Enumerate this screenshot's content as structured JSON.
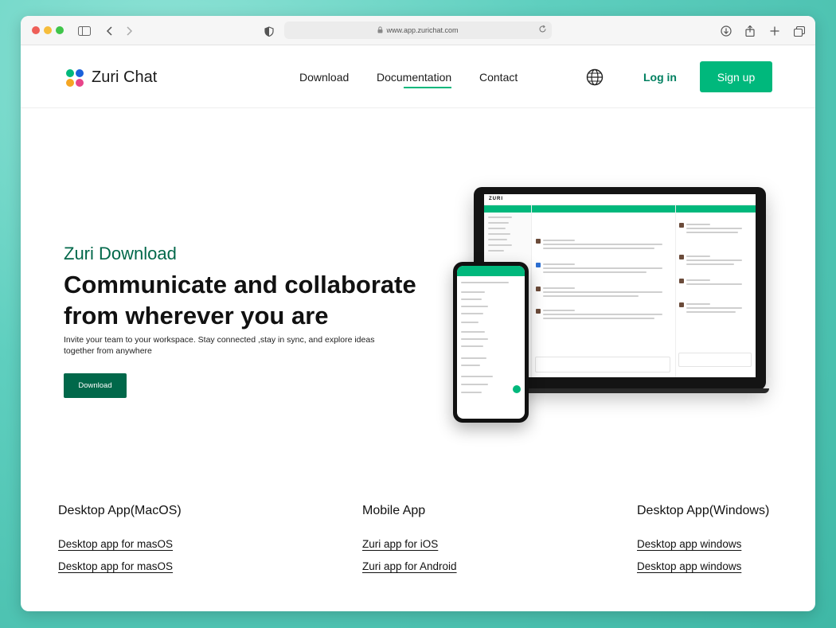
{
  "browser": {
    "url": "www.app.zurichat.com"
  },
  "header": {
    "brand": "Zuri Chat",
    "logo_colors": [
      "#00b87c",
      "#1a61db",
      "#f5a623",
      "#e8448a"
    ],
    "nav": [
      {
        "label": "Download"
      },
      {
        "label": "Documentation"
      },
      {
        "label": "Contact"
      }
    ],
    "active_nav": "Documentation",
    "login": "Log in",
    "signup": "Sign up"
  },
  "hero": {
    "kicker": "Zuri Download",
    "title": "Communicate and collaborate from wherever you are",
    "subtitle": "Invite your team to your workspace. Stay connected ,stay in sync, and explore ideas together from anywhere",
    "button": "Download"
  },
  "mockup": {
    "app_brand": "ZURI"
  },
  "downloads": [
    {
      "title": "Desktop App(MacOS)",
      "links": [
        "Desktop app for masOS",
        "Desktop app for masOS"
      ]
    },
    {
      "title": "Mobile App",
      "links": [
        "Zuri app for iOS",
        "Zuri app for Android"
      ]
    },
    {
      "title": "Desktop App(Windows)",
      "links": [
        "Desktop app windows",
        "Desktop app windows"
      ]
    }
  ],
  "colors": {
    "accent": "#00b87c",
    "accent_dark": "#01684a"
  }
}
